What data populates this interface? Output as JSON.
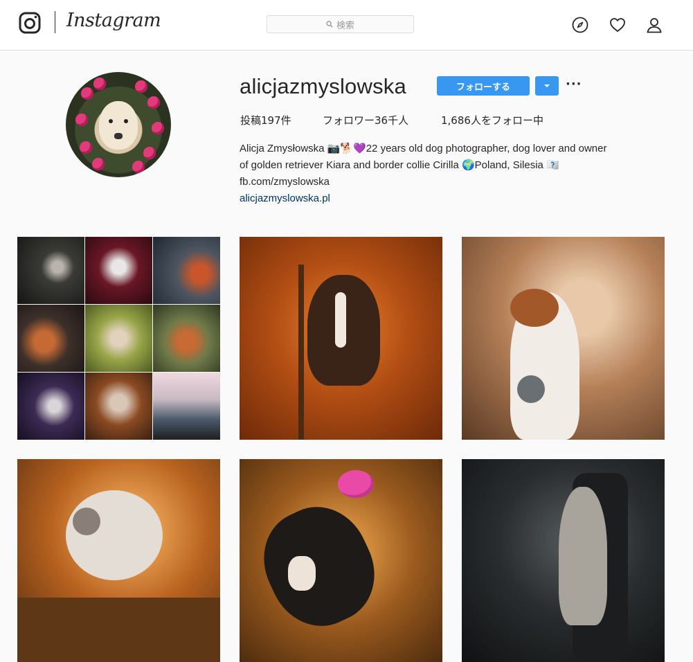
{
  "header": {
    "wordmark": "Instagram",
    "search_placeholder": "検索",
    "icons": [
      "instagram-logo-icon",
      "search-icon",
      "compass-icon",
      "heart-icon",
      "user-icon"
    ]
  },
  "profile": {
    "username": "alicjazmyslowska",
    "follow_label": "フォローする",
    "more_label": "···",
    "stats": {
      "posts": "投稿197件",
      "followers": "フォロワー36千人",
      "following": "1,686人をフォロー中"
    },
    "bio": {
      "line1": "Alicja Zmysłowska 📷🐕💜22 years old dog photographer, dog lover and owner",
      "line2": "of golden retriever Kiara and border collie Cirilla 🌍Poland, Silesia 🇫🇧",
      "line3": "fb.com/zmyslowska",
      "link": "alicjazmyslowska.pl"
    }
  },
  "colors": {
    "accent": "#3897f0",
    "link": "#003569",
    "border": "#dbdbdb",
    "background": "#fafafa"
  }
}
